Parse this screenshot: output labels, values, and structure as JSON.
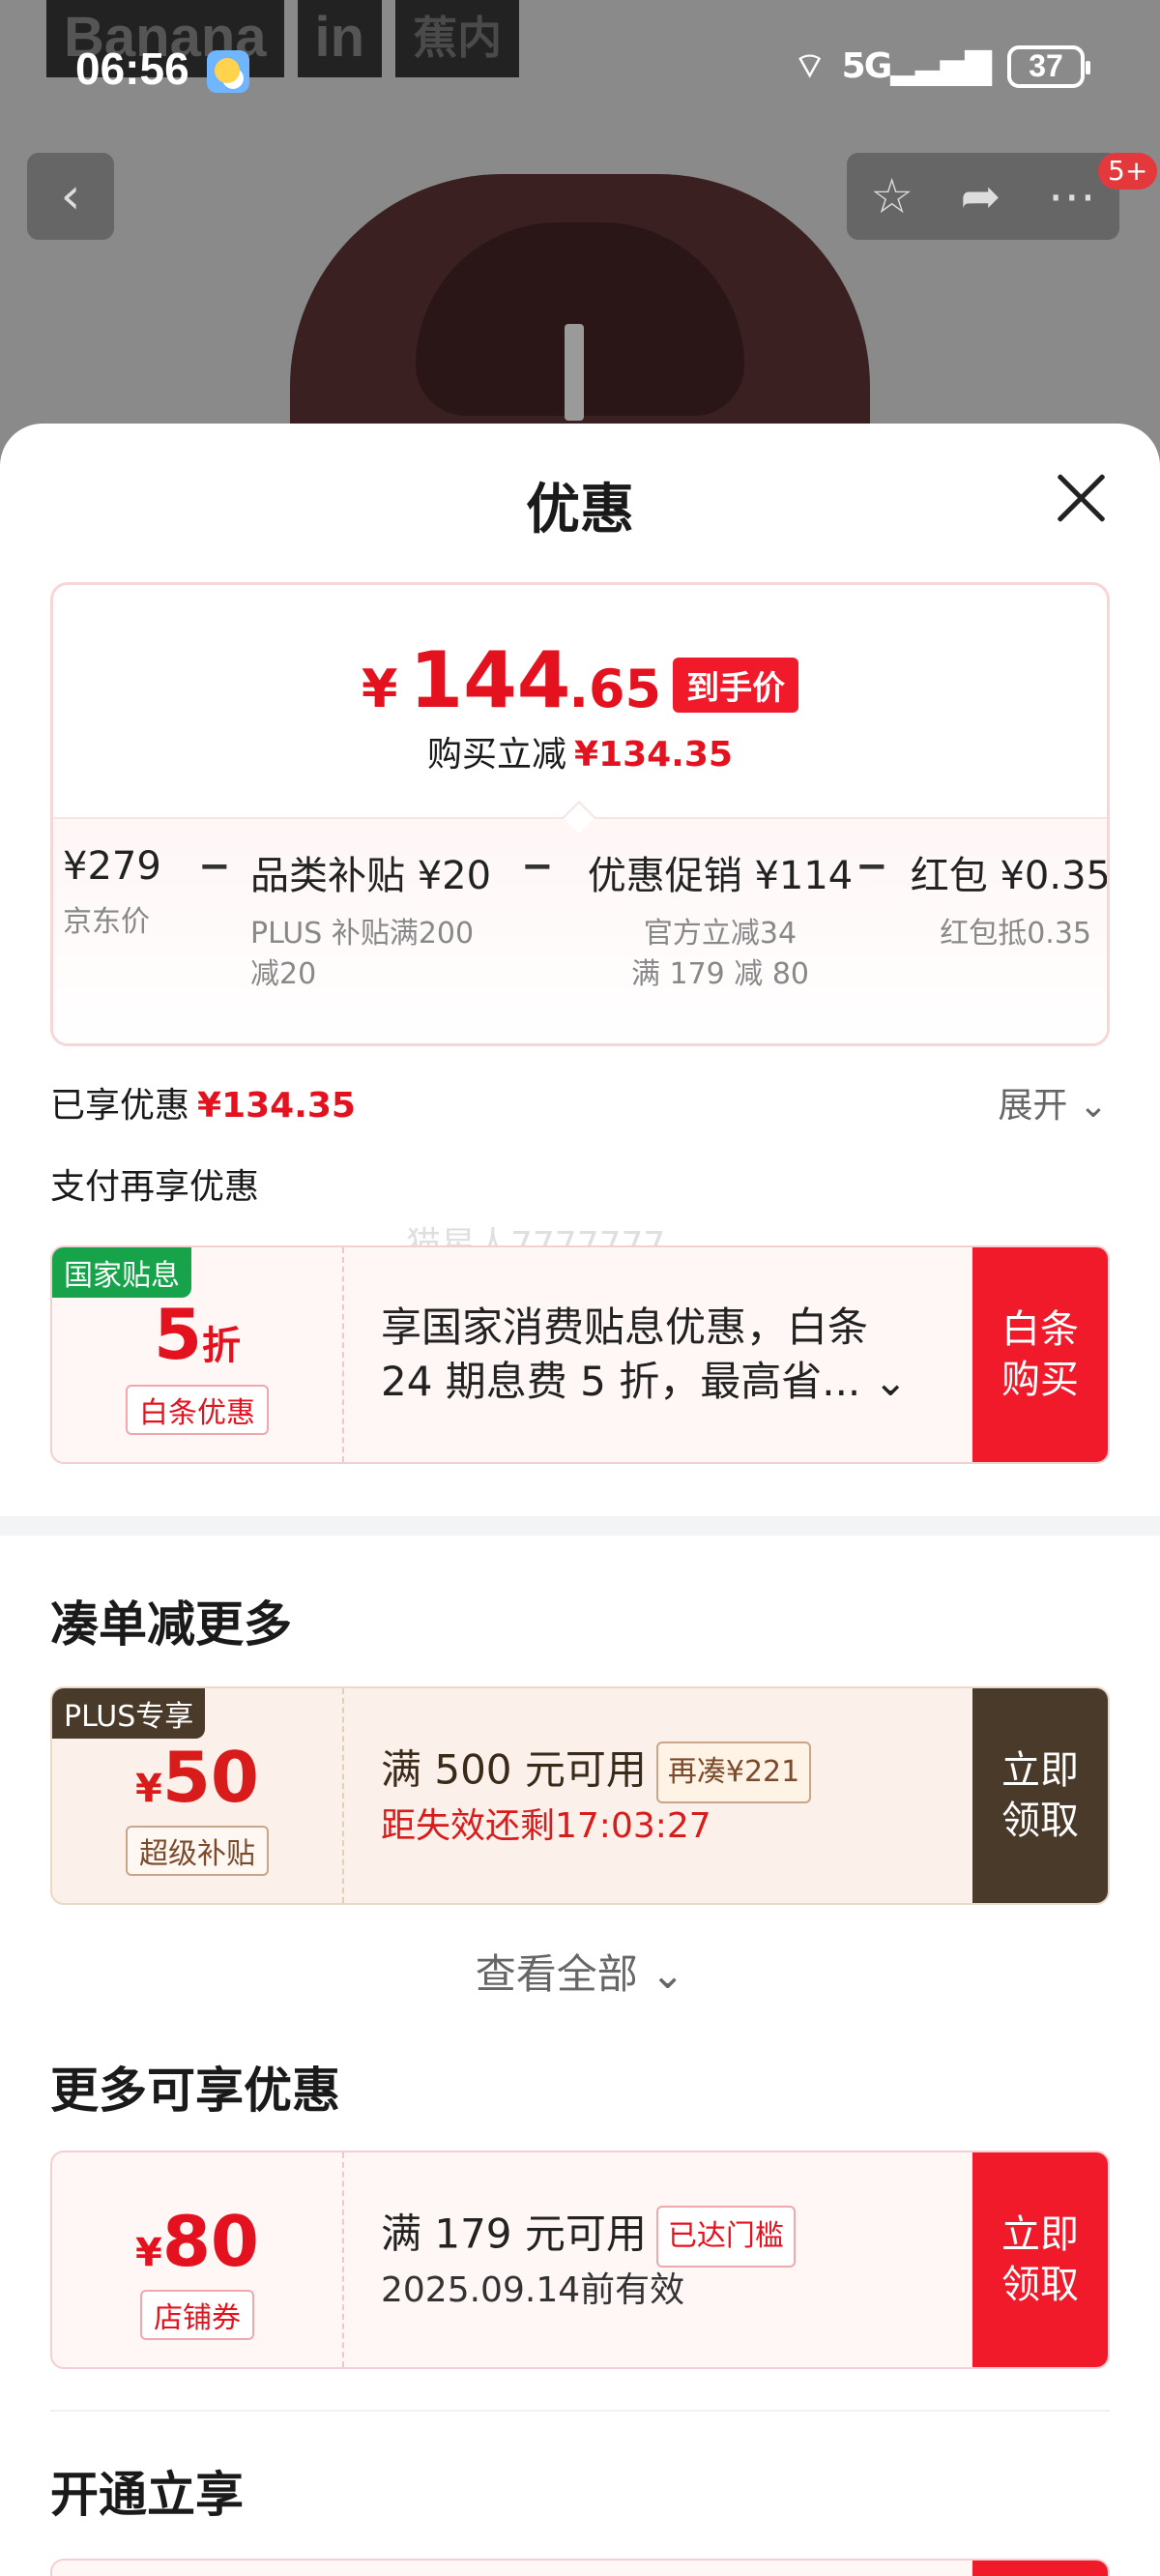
{
  "status_bar": {
    "time": "06:56",
    "network": "5G",
    "battery": "37"
  },
  "background": {
    "brand_a": "Banana",
    "brand_b": "in",
    "brand_c": "蕉内",
    "badge": "5+"
  },
  "sheet": {
    "title": "优惠"
  },
  "price": {
    "yen": "¥",
    "int": "144",
    "dec": ".65",
    "tag": "到手价",
    "reduce_label": "购买立减",
    "reduce_amount": "¥134.35"
  },
  "breakdown": [
    {
      "value": "¥279",
      "sub": "京东价"
    },
    {
      "value": "品类补贴 ¥20",
      "sub": "PLUS 补贴满200 减20"
    },
    {
      "value": "优惠促销 ¥114",
      "sub": "官方立减34",
      "sub2": "满 179 减 80"
    },
    {
      "value": "红包 ¥0.35",
      "sub": "红包抵0.35"
    }
  ],
  "enjoyed": {
    "label": "已享优惠",
    "amount": "¥134.35",
    "expand": "展开"
  },
  "pay_more": "支付再享优惠",
  "watermark": "猫星人7777777",
  "baitiao": {
    "tag": "国家贴息",
    "num": "5",
    "unit": "折",
    "chip": "白条优惠",
    "line1": "享国家消费贴息优惠，白条",
    "line2": "24 期息费 5 折，最高省...",
    "action": "白条购买"
  },
  "section_more": "凑单减更多",
  "plus_coupon": {
    "tag": "PLUS专享",
    "yen": "¥",
    "num": "50",
    "chip": "超级补贴",
    "title": "满 500 元可用",
    "inline_chip": "再凑¥221",
    "sub": "距失效还剩17:03:27",
    "action": "立即领取"
  },
  "see_all": "查看全部",
  "section_enjoy": "更多可享优惠",
  "shop_coupon": {
    "yen": "¥",
    "num": "80",
    "chip": "店铺券",
    "title": "满 179 元可用",
    "inline_chip": "已达门槛",
    "sub": "2025.09.14前有效",
    "action": "立即领取"
  },
  "section_open": "开通立享",
  "colors": {
    "accent_red": "#f01a2a",
    "price_red": "#e4121e",
    "gold_dark": "#4a3a2a",
    "green": "#16a34a"
  }
}
